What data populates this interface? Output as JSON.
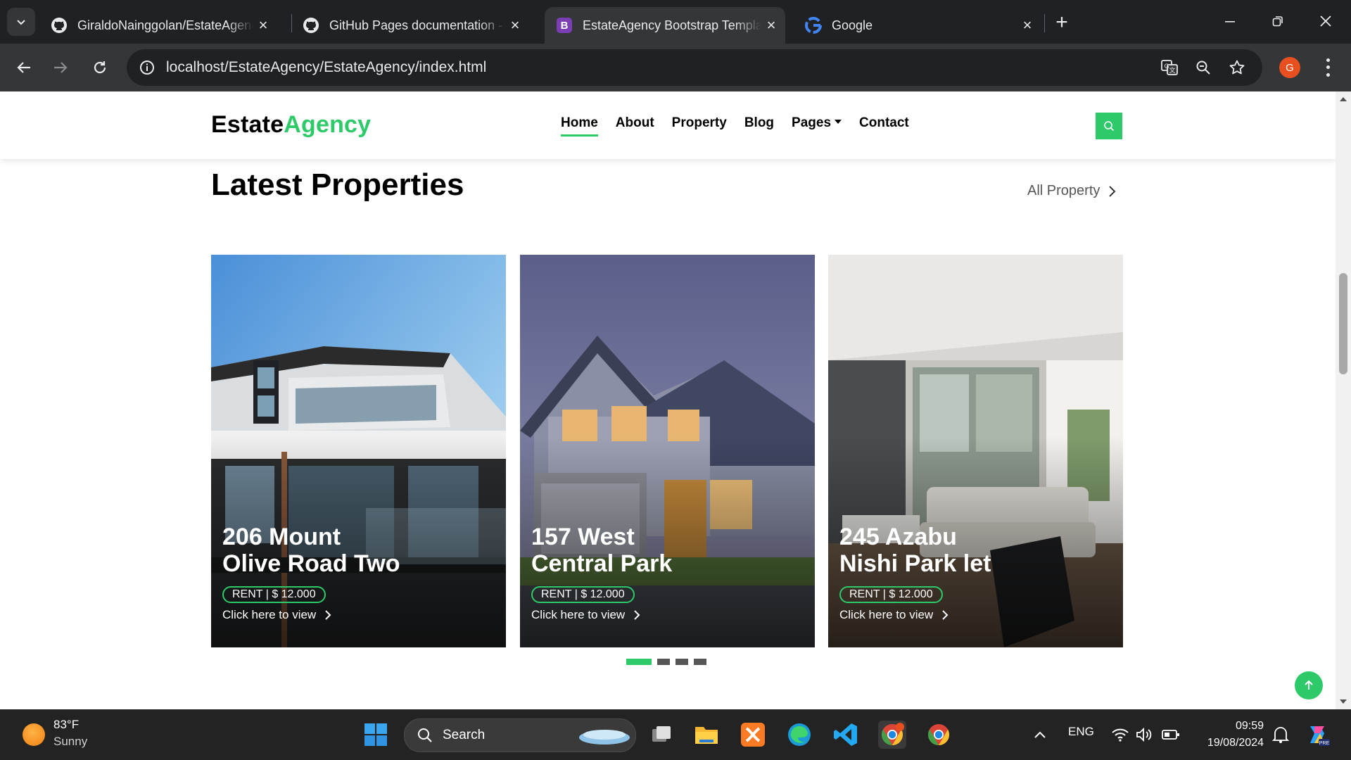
{
  "browser": {
    "tabs": [
      {
        "title": "GiraldoNainggolan/EstateAgency",
        "icon": "github-icon",
        "active": false
      },
      {
        "title": "GitHub Pages documentation - GitHub Docs",
        "icon": "github-icon",
        "active": false
      },
      {
        "title": "EstateAgency Bootstrap Template",
        "icon": "bootstrap-icon",
        "active": true
      },
      {
        "title": "Google",
        "icon": "google-icon",
        "active": false
      }
    ],
    "url": "localhost/EstateAgency/EstateAgency/index.html",
    "profile_initial": "G"
  },
  "site": {
    "brand_main": "Estate",
    "brand_accent": "Agency",
    "accent_color": "#2eca6a",
    "nav": [
      {
        "label": "Home",
        "active": true
      },
      {
        "label": "About",
        "active": false
      },
      {
        "label": "Property",
        "active": false
      },
      {
        "label": "Blog",
        "active": false
      },
      {
        "label": "Pages",
        "active": false,
        "dropdown": true
      },
      {
        "label": "Contact",
        "active": false
      }
    ],
    "section_title": "Latest Properties",
    "all_link": "All Property",
    "cards": [
      {
        "title_line1": "206 Mount",
        "title_line2": "Olive Road Two",
        "price": "RENT | $ 12.000",
        "cta": "Click here to view"
      },
      {
        "title_line1": "157 West",
        "title_line2": "Central Park",
        "price": "RENT | $ 12.000",
        "cta": "Click here to view"
      },
      {
        "title_line1": "245 Azabu",
        "title_line2": "Nishi Park let",
        "price": "RENT | $ 12.000",
        "cta": "Click here to view"
      }
    ],
    "carousel_pages": 4,
    "carousel_active": 1
  },
  "taskbar": {
    "weather_temp": "83°F",
    "weather_desc": "Sunny",
    "search_label": "Search",
    "language": "ENG",
    "time": "09:59",
    "date": "19/08/2024"
  }
}
